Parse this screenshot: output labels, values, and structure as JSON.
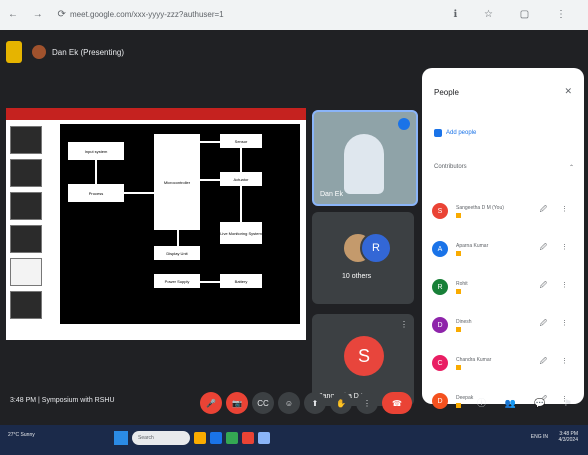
{
  "browser": {
    "nav_icons": [
      "back-icon",
      "forward-icon",
      "reload-icon"
    ],
    "nav_glyphs": "← → ⟳",
    "url": "meet.google.com/xxx-yyyy-zzz?authuser=1",
    "right_glyphs": "ℹ ☆ ▢ ⋮"
  },
  "meet": {
    "presenting_label": "Dan Ek (Presenting)",
    "tiles": [
      {
        "name": "Dan Ek"
      },
      {
        "name": "10 others",
        "avatar_letter": "R"
      },
      {
        "name": "Sangeetha D M",
        "avatar_letter": "S"
      }
    ],
    "tile_menu_glyph": "⋮",
    "slide": {
      "boxes": [
        "Input system",
        "Process",
        "Microcontroller",
        "Sensor",
        "Actuator",
        "Display Unit",
        "Live Monitoring System",
        "Battery",
        "Power Supply"
      ]
    }
  },
  "panel": {
    "title": "People",
    "close_glyph": "✕",
    "add_people": "Add people",
    "contributors_label": "Contributors",
    "contributors_glyphs": "⌃",
    "row_actions_glyphs": "🖉 ⋮",
    "people": [
      {
        "letter": "S",
        "name": "Sangeetha D M (You)",
        "color": "#ea4335"
      },
      {
        "letter": "A",
        "name": "Aparna Kumar",
        "color": "#1a73e8"
      },
      {
        "letter": "R",
        "name": "Rohit",
        "color": "#188038"
      },
      {
        "letter": "D",
        "name": "Dinesh",
        "color": "#8e24aa"
      },
      {
        "letter": "C",
        "name": "Chandra Kumar",
        "color": "#e91e63"
      },
      {
        "letter": "D",
        "name": "Deepak",
        "color": "#f4511e"
      }
    ]
  },
  "controls": {
    "meeting_info": "3:48 PM  |  Symposium with RSHU",
    "buttons": [
      "mic-off",
      "cam-off",
      "captions",
      "emoji",
      "present",
      "raise-hand",
      "more",
      "end-call"
    ],
    "button_glyphs": [
      "🎤",
      "📷",
      "CC",
      "☺",
      "⬆",
      "✋",
      "⋮",
      "☎"
    ],
    "right_glyphs": "ⓘ 👥 💬 ⚑"
  },
  "taskbar": {
    "weather": "27°C Sunny",
    "search_placeholder": "Search",
    "tray": "ENG IN",
    "time": "3:48 PM",
    "date": "4/3/2024"
  }
}
